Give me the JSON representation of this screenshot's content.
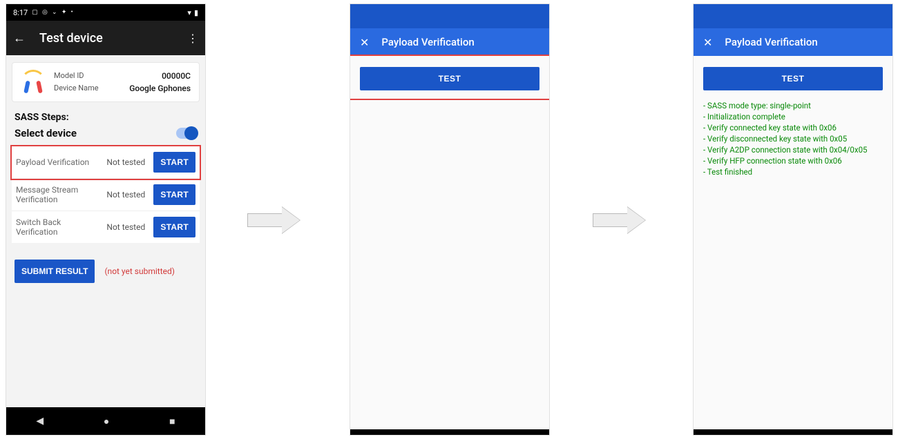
{
  "status": {
    "time": "8:17",
    "right_icons": "▾ ▮",
    "left_icons": "⦿ ⦿ ✢ ⚙ ·"
  },
  "screen1": {
    "title": "Test device",
    "card": {
      "model_label": "Model ID",
      "model_value": "00000C",
      "name_label": "Device Name",
      "name_value": "Google Gphones"
    },
    "sass_label": "SASS Steps:",
    "select_label": "Select device",
    "rows": [
      {
        "name": "Payload Verification",
        "status": "Not tested",
        "btn": "START"
      },
      {
        "name": "Message Stream Verification",
        "status": "Not tested",
        "btn": "START"
      },
      {
        "name": "Switch Back Verification",
        "status": "Not tested",
        "btn": "START"
      }
    ],
    "submit_btn": "SUBMIT RESULT",
    "submit_note": "(not yet submitted)"
  },
  "screen2": {
    "title": "Payload Verification",
    "test_btn": "TEST"
  },
  "screen3": {
    "title": "Payload Verification",
    "test_btn": "TEST",
    "log": [
      "- SASS mode type: single-point",
      "- Initialization complete",
      "- Verify connected key state with 0x06",
      "- Verify disconnected key state with 0x05",
      "- Verify A2DP connection state with 0x04/0x05",
      "- Verify HFP connection state with 0x06",
      "- Test finished"
    ]
  }
}
